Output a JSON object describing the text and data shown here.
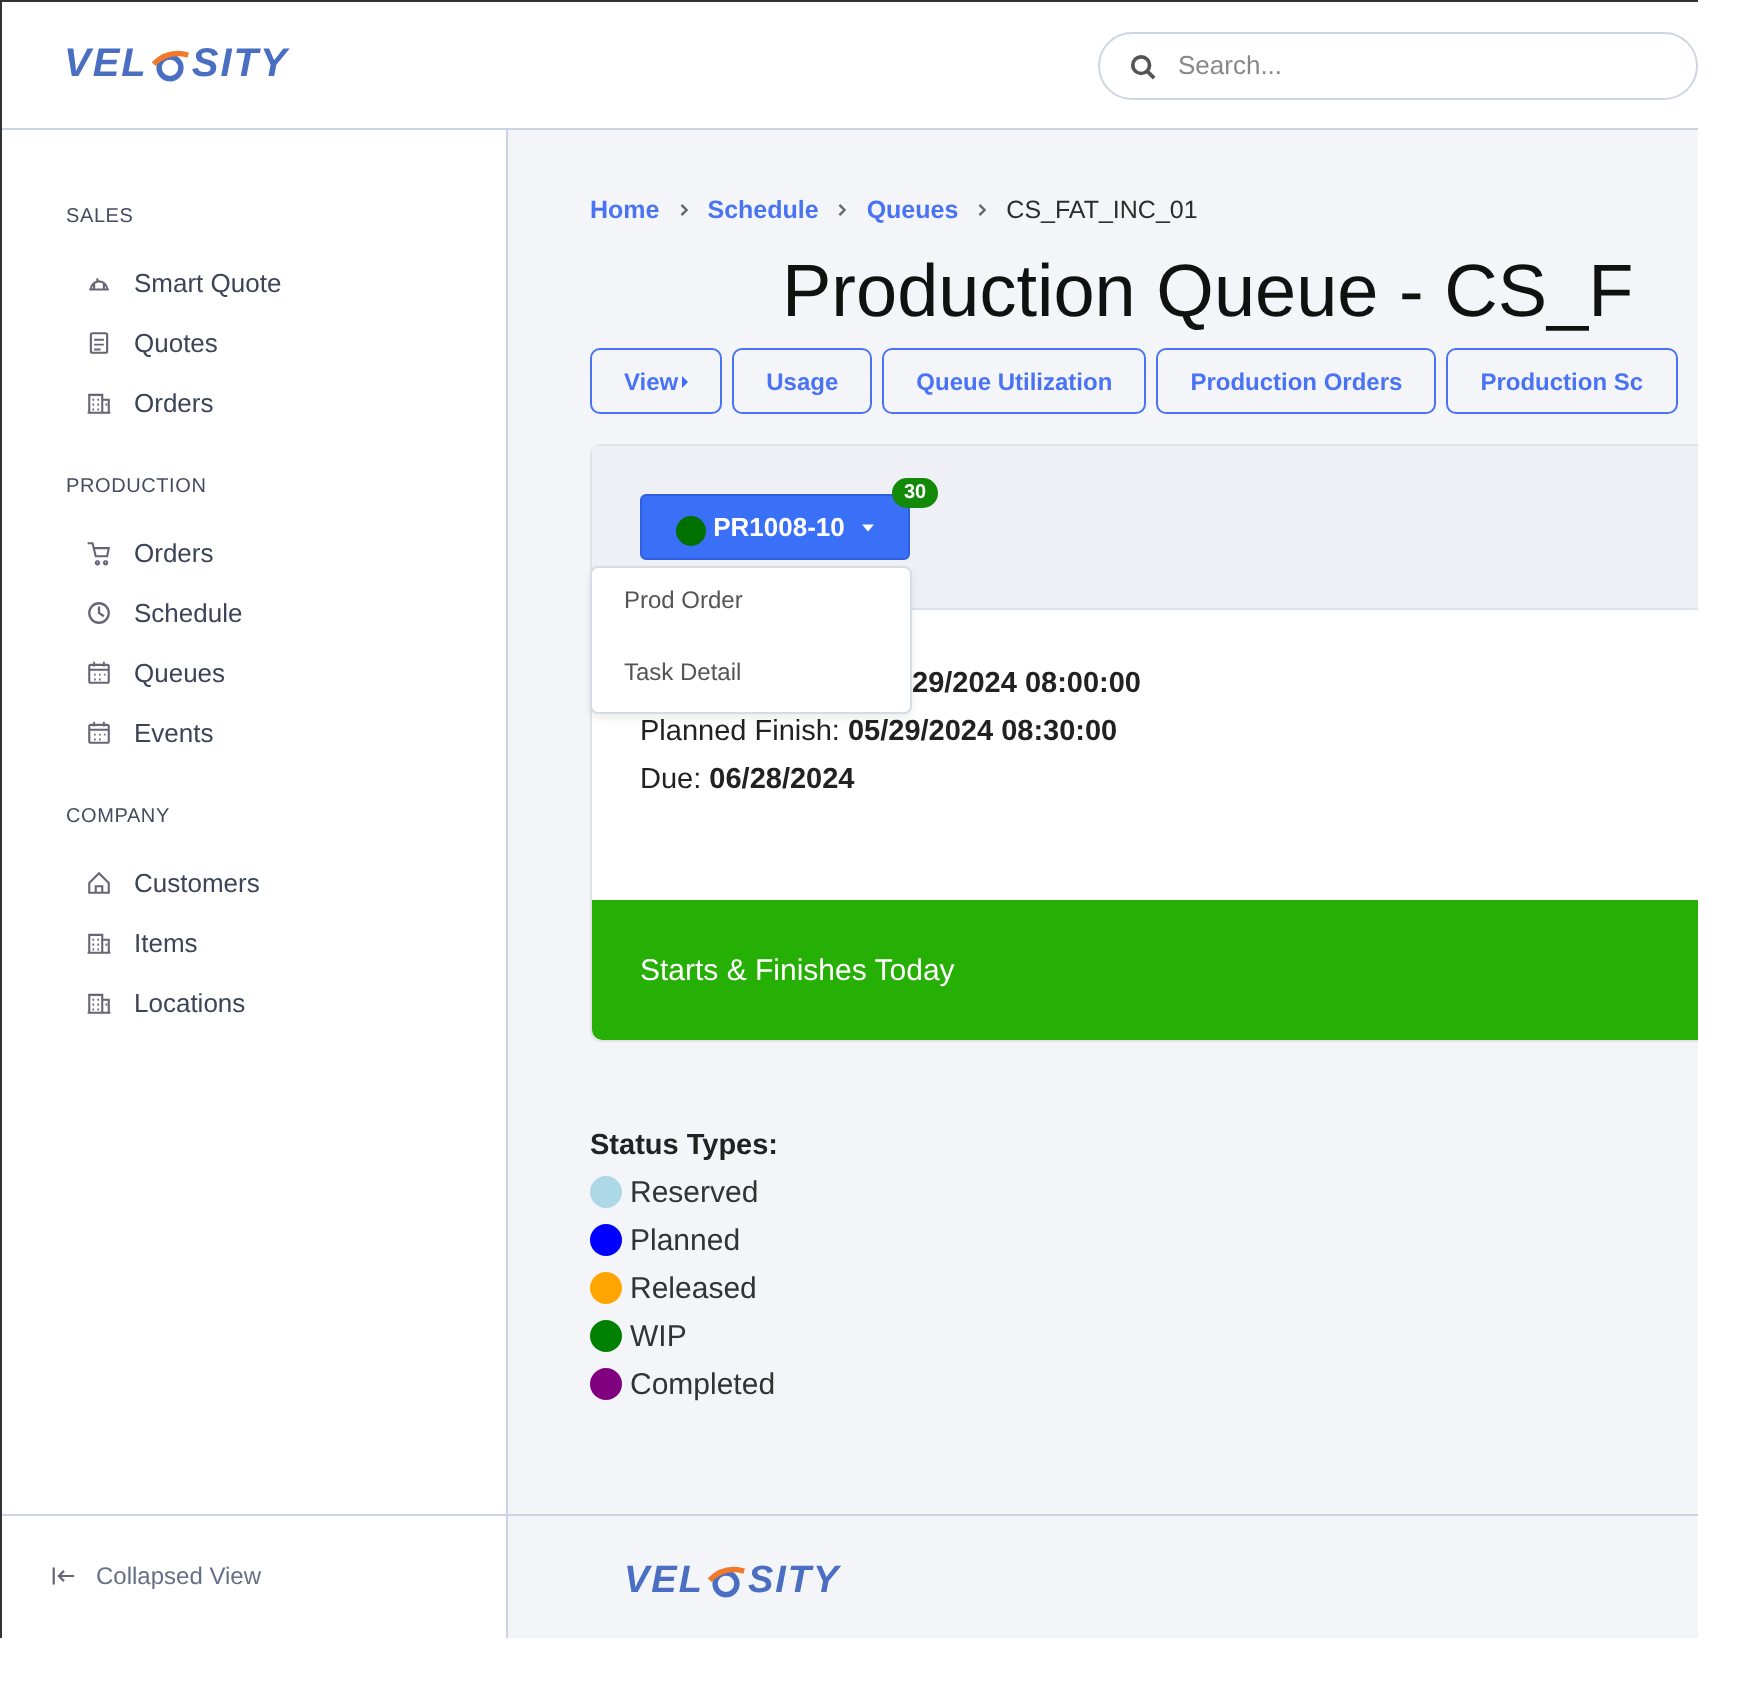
{
  "header": {
    "logo": {
      "left": "VEL",
      "right": "SITY"
    },
    "search": {
      "placeholder": "Search..."
    }
  },
  "sidebar": {
    "sections": [
      {
        "title": "SALES",
        "items": [
          {
            "label": "Smart Quote"
          },
          {
            "label": "Quotes"
          },
          {
            "label": "Orders"
          }
        ]
      },
      {
        "title": "PRODUCTION",
        "items": [
          {
            "label": "Orders"
          },
          {
            "label": "Schedule"
          },
          {
            "label": "Queues"
          },
          {
            "label": "Events"
          }
        ]
      },
      {
        "title": "COMPANY",
        "items": [
          {
            "label": "Customers"
          },
          {
            "label": "Items"
          },
          {
            "label": "Locations"
          }
        ]
      }
    ],
    "footer": {
      "label": "Collapsed View"
    }
  },
  "breadcrumb": [
    {
      "label": "Home",
      "link": true
    },
    {
      "label": "Schedule",
      "link": true
    },
    {
      "label": "Queues",
      "link": true
    },
    {
      "label": "CS_FAT_INC_01",
      "link": false
    }
  ],
  "title": "Production Queue - CS_F",
  "toolbar": [
    {
      "label": "View",
      "caret": true
    },
    {
      "label": "Usage",
      "caret": false
    },
    {
      "label": "Queue Utilization",
      "caret": false
    },
    {
      "label": "Production Orders",
      "caret": false
    },
    {
      "label": "Production Sc",
      "caret": false
    }
  ],
  "card": {
    "order_button": {
      "label": "PR1008-10",
      "color": "#007000",
      "badge": "30"
    },
    "menu": [
      {
        "label": "Prod Order"
      },
      {
        "label": "Task Detail"
      }
    ],
    "lines": [
      {
        "value": "29/2024 08:00:00"
      },
      {
        "label": "Planned Finish: ",
        "value": "05/29/2024 08:30:00"
      },
      {
        "label": "Due: ",
        "value": "06/28/2024"
      }
    ],
    "banner": {
      "text": "Starts & Finishes Today",
      "color": "#26b005"
    }
  },
  "legend": {
    "title": "Status Types:",
    "items": [
      {
        "label": "Reserved",
        "color": "#add8e6"
      },
      {
        "label": "Planned",
        "color": "#0000ff"
      },
      {
        "label": "Released",
        "color": "#ffa500"
      },
      {
        "label": "WIP",
        "color": "#008000"
      },
      {
        "label": "Completed",
        "color": "#800080"
      }
    ]
  },
  "footer": {
    "logo": {
      "left": "VEL",
      "right": "SITY"
    }
  }
}
